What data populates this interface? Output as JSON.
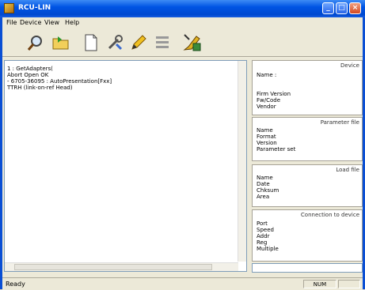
{
  "window": {
    "title": "RCU-LIN",
    "minimize": "_",
    "maximize": "□",
    "close": "×"
  },
  "menu": {
    "items": [
      "File",
      "Device",
      "View",
      "Help"
    ]
  },
  "toolbar": {
    "tools": [
      "search-icon",
      "open-folder-icon",
      "new-document-icon",
      "wrench-icon",
      "pencil-icon",
      "list-icon",
      "pen-tool-icon"
    ]
  },
  "log": {
    "lines": [
      "1 : GetAdapters(",
      "Abort Open OK",
      "  - 6705-36095 : AutoPresentation[Fxx]",
      "TTRH (link-on-ref Head)"
    ]
  },
  "panels": {
    "device": {
      "title": "Device",
      "rows": [
        "Name :",
        "",
        "Firm Version",
        "Fw/Code",
        "Vendor"
      ]
    },
    "parameter": {
      "title": "Parameter file",
      "rows": [
        "Name",
        "Format",
        "Version",
        "Parameter set"
      ]
    },
    "load": {
      "title": "Load file",
      "rows": [
        "Name",
        "Date",
        "Chksum",
        "Area"
      ]
    },
    "connection": {
      "title": "Connection to device",
      "rows": [
        "Port",
        "Speed",
        "Addr",
        "Reg",
        "Multiple"
      ]
    }
  },
  "status": {
    "text": "Ready",
    "pane_right": "NUM"
  }
}
